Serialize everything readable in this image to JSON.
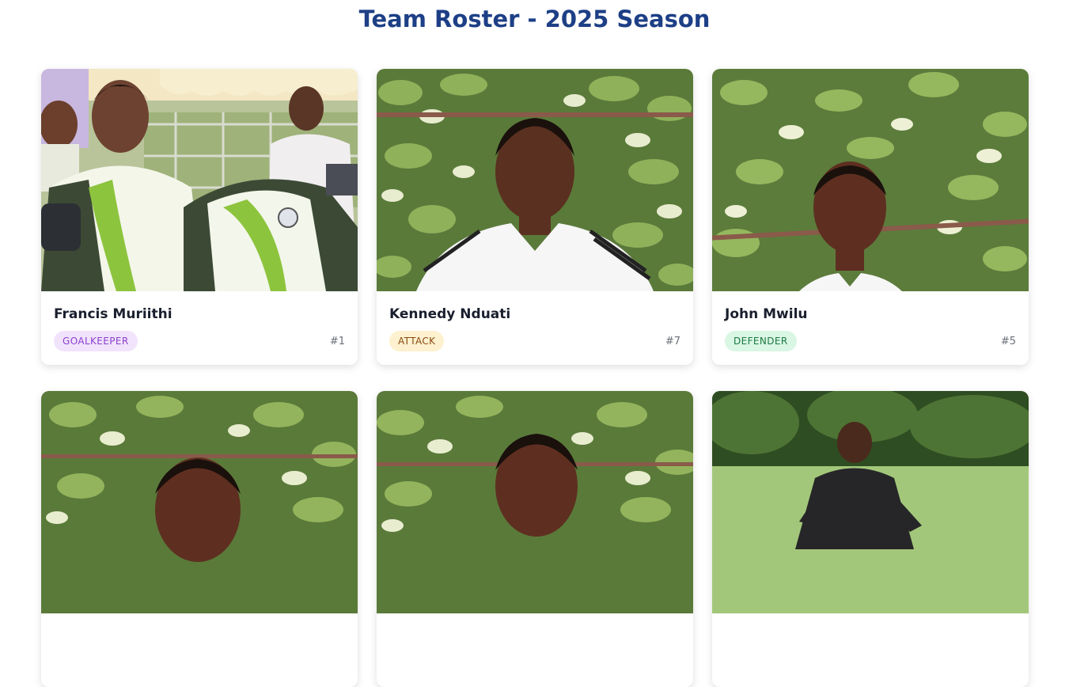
{
  "page": {
    "title": "Team Roster - 2025 Season"
  },
  "players": [
    {
      "name": "Francis Muriithi",
      "position": "GOALKEEPER",
      "number": "#1",
      "badge_bg": "#f1e3fc",
      "badge_fg": "#8b3fcf",
      "photo": "goalkeeper-jersey-presentation"
    },
    {
      "name": "Kennedy Nduati",
      "position": "ATTACK",
      "number": "#7",
      "badge_bg": "#fdf1cf",
      "badge_fg": "#8a4b12",
      "photo": "player-portrait-leaves"
    },
    {
      "name": "John Mwilu",
      "position": "DEFENDER",
      "number": "#5",
      "badge_bg": "#daf6e4",
      "badge_fg": "#1d7a43",
      "photo": "player-portrait-leaves"
    },
    {
      "name": "",
      "position": "",
      "number": "",
      "badge_bg": "#eeeeee",
      "badge_fg": "#555555",
      "photo": "player-portrait-leaves"
    },
    {
      "name": "",
      "position": "",
      "number": "",
      "badge_bg": "#eeeeee",
      "badge_fg": "#555555",
      "photo": "player-portrait-leaves"
    },
    {
      "name": "",
      "position": "",
      "number": "",
      "badge_bg": "#eeeeee",
      "badge_fg": "#555555",
      "photo": "referee-field"
    }
  ]
}
